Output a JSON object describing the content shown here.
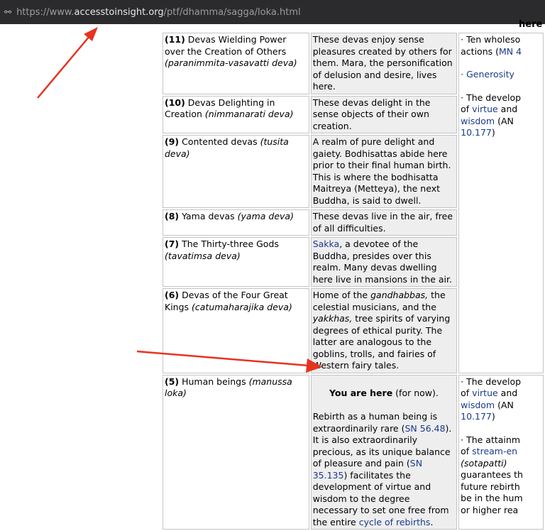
{
  "browser": {
    "url_prefix": "https://www.",
    "url_domain": "accesstoinsight.org",
    "url_path": "/ptf/dhamma/sagga/loka.html"
  },
  "header_partial": "here",
  "rows": [
    {
      "num": "(11)",
      "name": " Devas Wielding Power over the Creation of Others ",
      "pali": "(paranimmita-vasavatti deva)",
      "desc": "These devas enjoy sense pleasures created by others for them. Mara, the personification of delusion and desire, lives here."
    },
    {
      "num": "(10)",
      "name": " Devas Delighting in Creation ",
      "pali": "(nimmanarati deva)",
      "desc": "These devas delight in the sense objects of their own creation."
    },
    {
      "num": "(9)",
      "name": " Contented devas ",
      "pali": "(tusita deva)",
      "desc": "A realm of pure delight and gaiety. Bodhisattas abide here prior to their final human birth. This is where the bodhisatta Maitreya (Metteya), the next Buddha, is said to dwell."
    },
    {
      "num": "(8)",
      "name": " Yama devas ",
      "pali": "(yama deva)",
      "desc": "These devas live in the air, free of all difficulties."
    },
    {
      "num": "(7)",
      "name": " The Thirty-three Gods ",
      "pali": "(tavatimsa deva)",
      "desc_link": "Sakka",
      "desc": ", a devotee of the Buddha, presides over this realm. Many devas dwelling here live in mansions in the air."
    },
    {
      "num": "(6)",
      "name": " Devas of the Four Great Kings ",
      "pali": "(catumaharajika deva)",
      "desc_a": "Home of the ",
      "desc_i1": "gandhabbas,",
      "desc_b": " the celestial musicians, and the ",
      "desc_i2": "yakkhas,",
      "desc_c": " tree spirits of varying degrees of ethical purity. The latter are analogous to the goblins, trolls, and fairies of Western fairy tales."
    },
    {
      "num": "(5)",
      "name": " Human beings ",
      "pali": "(manussa loka)",
      "here_bold": "You are here",
      "here_rest": " (for now).",
      "p1": "Rebirth as a human being is extraordinarily rare (",
      "link1": "SN 56.48",
      "p2": "). It is also extraordinarily precious, as its unique balance of pleasure and pain (",
      "link2": "SN 35.135",
      "p3": ") facilitates the development of virtue and wisdom to the degree necessary to set one free from the entire ",
      "link3": "cycle of rebirths",
      "p4": "."
    }
  ],
  "col3_upper": {
    "l1": "· Ten wholeso",
    "l2a": "actions (",
    "l2link": "MN 4",
    "l3": "· Generosity",
    "l4": "· The develop",
    "l5a": "of ",
    "l5link": "virtue",
    "l5b": " and",
    "l6link": "wisdom",
    "l6b": " (AN",
    "l7link": "10.177",
    "l7b": ")"
  },
  "col3_lower": {
    "l1": "· The develop",
    "l2a": "of ",
    "l2link": "virtue",
    "l2b": " and",
    "l3link": "wisdom",
    "l3b": " (AN",
    "l4link": "10.177",
    "l4b": ")",
    "l5": "· The attainm",
    "l6a": "of ",
    "l6link": "stream-en",
    "l7": "(sotapatti)",
    "l8": "guarantees th",
    "l9": "future rebirth",
    "l10": "be in the hum",
    "l11": "or higher rea"
  },
  "colors": {
    "link": "#1b3a8c",
    "arrow": "#e8321f",
    "desc_bg": "#eeeeee",
    "urlbar_bg": "#2b2b2e"
  }
}
